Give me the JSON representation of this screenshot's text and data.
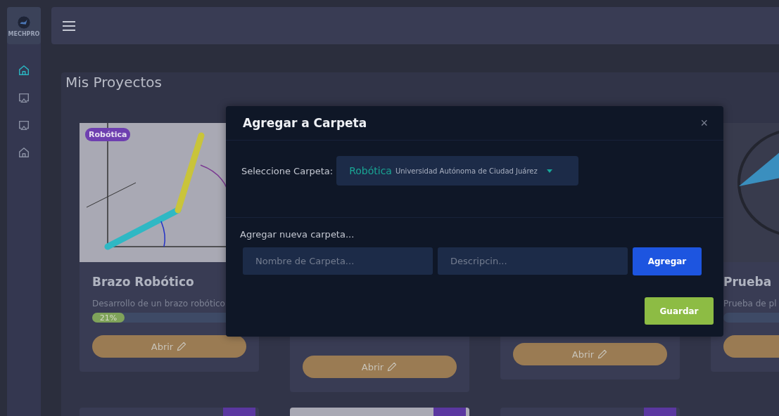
{
  "sidebar": {
    "logo_text": "MECHPRO",
    "items": [
      {
        "kind": "home",
        "selected": true
      },
      {
        "kind": "screen",
        "selected": false
      },
      {
        "kind": "screen",
        "selected": false
      },
      {
        "kind": "home",
        "selected": false
      }
    ]
  },
  "page_title": "Mis Proyectos",
  "projects": [
    {
      "kind": "arm",
      "tag": "Robótica",
      "title": "Brazo Robótico",
      "description": "Desarrollo de un brazo robótico",
      "progress_label": "21%",
      "level": 0.21,
      "button": "Abrir"
    },
    {
      "kind": "hidden",
      "button": "Abrir"
    },
    {
      "kind": "hidden",
      "button": "Abrir"
    },
    {
      "kind": "logo",
      "title": "Prueba",
      "description": "Prueba de pl",
      "level": 0
    }
  ],
  "modal": {
    "title": "Agregar a Carpeta",
    "close": "×",
    "select_label": "Seleccione Carpeta:",
    "select_value": "Robótica",
    "select_detail": "Universidad Autónoma de Ciudad Juárez",
    "new_label": "Agregar nueva carpeta...",
    "name_placeholder": "Nombre de Carpeta...",
    "desc_placeholder": "Descripcin...",
    "add_button": "Agregar",
    "save_button": "Guardar"
  }
}
